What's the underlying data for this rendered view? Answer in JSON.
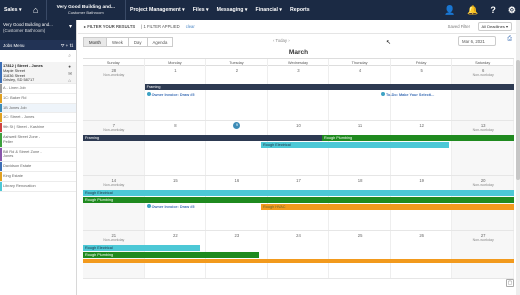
{
  "topbar": {
    "sales": "Sales ▾",
    "project": "Very Good Building and...",
    "project_sub": "Customer Bathroom",
    "project_mgmt": "Project Management ▾",
    "files": "Files ▾",
    "messaging": "Messaging ▾",
    "financial": "Financial ▾",
    "reports": "Reports"
  },
  "sidebar": {
    "head_title": "Very Good Building and...",
    "head_sub": "(Customer Bathroom)",
    "tools_label": "Jobs Menu",
    "items": [
      {
        "line1": "17812 | Street - Jones",
        "line2": "Maple Street",
        "line3": "11836 Street",
        "line4": "Grisley, SD 58717",
        "color": "#3d6fb6"
      },
      {
        "line1": "A - Linen Job",
        "color": "#999999"
      },
      {
        "line1": "1C: Baker Rd",
        "color": "#e0a020"
      },
      {
        "line1": "1B Jones Job",
        "color": "#3d8cb7"
      },
      {
        "line1": "1C: Street - Jones",
        "color": "#e0a020"
      },
      {
        "line1": "9th St | Street - Kashine",
        "color": "#d04040"
      },
      {
        "line1": "Ashwell Street Zone -",
        "line2": "Peller",
        "color": "#3da03d"
      },
      {
        "line1": "Bill Rd & Street Zone -",
        "line2": "Jones",
        "color": "#8855aa"
      },
      {
        "line1": "Davidson Estate",
        "color": "#3d6fb6"
      },
      {
        "line1": "King Estate",
        "color": "#e0a020"
      },
      {
        "line1": "Library Renovation",
        "color": "#4cc8d6"
      }
    ]
  },
  "filters": {
    "filter_label": "FILTER YOUR RESULTS",
    "applied": "1 FILTER APPLIED",
    "clear": "clear",
    "saved_label": "Saved Filter",
    "saved_value": "All Deadlines ▾"
  },
  "toolbar": {
    "views": [
      "Month",
      "Week",
      "Day",
      "Agenda"
    ],
    "today": "‹   Today   ›",
    "date": "Mar 6, 2021",
    "print": "⎙"
  },
  "calendar": {
    "month": "March",
    "dow": [
      "Sunday",
      "Monday",
      "Tuesday",
      "Wednesday",
      "Thursday",
      "Friday",
      "Saturday"
    ],
    "weeks": [
      {
        "days": [
          "28",
          "1",
          "2",
          "3",
          "4",
          "5",
          "6"
        ],
        "nonworking": [
          "Non-workday",
          "",
          "",
          "",
          "",
          "",
          "Non-workday"
        ]
      },
      {
        "days": [
          "7",
          "8",
          "9",
          "10",
          "11",
          "12",
          "13"
        ],
        "nonworking": [
          "Non-workday",
          "",
          "",
          "",
          "",
          "",
          "Non-workday"
        ]
      },
      {
        "days": [
          "14",
          "15",
          "16",
          "17",
          "18",
          "19",
          "20"
        ],
        "nonworking": [
          "Non-workday",
          "",
          "",
          "",
          "",
          "",
          "Non-workday"
        ]
      },
      {
        "days": [
          "21",
          "22",
          "23",
          "24",
          "25",
          "26",
          "27"
        ],
        "nonworking": [
          "Non-workday",
          "",
          "",
          "",
          "",
          "",
          "Non-workday"
        ]
      }
    ],
    "events": {
      "framing": "Framing",
      "owner1": "Owner Invoice: Draw #5",
      "todo": "To-Do: Make Your Selecti...",
      "framing2": "Framing",
      "rough_plumb": "Rough Plumbing",
      "rough_elec": "Rough Electrical",
      "rough_elec2": "Rough Electrical",
      "rough_plumb2": "Rough Plumbing",
      "owner2": "Owner Invoice: Draw #5",
      "rough_hvac": "Rough HVAC",
      "rough_elec3": "Rough Electrical",
      "rough_plumb3": "Rough Plumbing"
    }
  },
  "colors": {
    "nav": "#1b2a44",
    "framing": "#2d3a52",
    "plumbing": "#1f8a1f",
    "electrical": "#4cc8d6",
    "hvac": "#f29a1d"
  }
}
